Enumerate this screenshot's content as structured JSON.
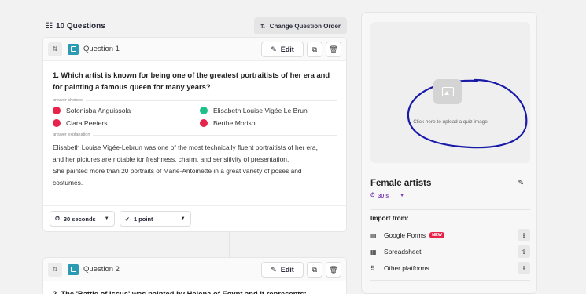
{
  "header": {
    "list_icon": "list-numbered-icon",
    "question_count": "10 Questions",
    "change_order_label": "Change Question Order"
  },
  "questions": [
    {
      "label": "Question 1",
      "text": "1.   Which artist is known for being one of the greatest portraitists of her era and for painting a famous queen for many years?",
      "answer_choices_label": "answer choices",
      "choices": [
        {
          "text": "Sofonisba Anguissola",
          "correct": false
        },
        {
          "text": "Elisabeth Louise Vigée Le Brun",
          "correct": true
        },
        {
          "text": "Clara Peeters",
          "correct": false
        },
        {
          "text": "Berthe Morisot",
          "correct": false
        }
      ],
      "answer_explanation_label": "answer explanation",
      "explanation_lines": [
        "Elisabeth Louise Vigée-Lebrun was one of the most technically fluent portraitists of her era,",
        "and her pictures are notable for freshness, charm, and sensitivity of presentation.",
        "She painted more than 20 portraits of Marie-Antoinette in a great variety of poses and",
        "costumes."
      ],
      "time": "30 seconds",
      "points": "1 point"
    },
    {
      "label": "Question 2",
      "text": "2.   The 'Battle of Issus' was painted by Helena of Egypt and it represents:"
    }
  ],
  "toolbar": {
    "edit_label": "Edit"
  },
  "sidebar": {
    "upload_text": "Click here to upload a quiz image",
    "quiz_title": "Female artists",
    "quiz_time": "30 s",
    "import_label": "Import from:",
    "import_options": [
      {
        "label": "Google Forms",
        "badge": "NEW",
        "icon": "google-forms-icon"
      },
      {
        "label": "Spreadsheet",
        "badge": "",
        "icon": "spreadsheet-icon"
      },
      {
        "label": "Other platforms",
        "badge": "",
        "icon": "grid-icon"
      }
    ]
  },
  "colors": {
    "correct": "#1fbf8a",
    "incorrect": "#e5234b",
    "accent": "#2a9bb2",
    "annotation": "#1a1aa8",
    "time_accent": "#7b3fb2"
  }
}
